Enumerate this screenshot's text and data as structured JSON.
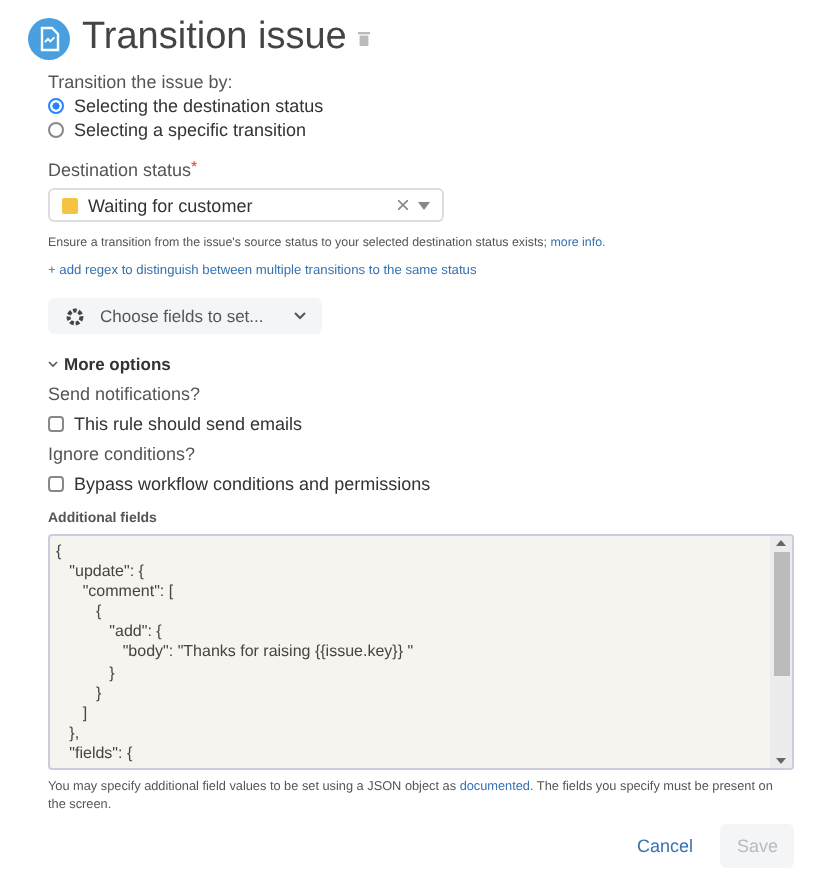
{
  "header": {
    "title": "Transition issue"
  },
  "transition_by": {
    "label": "Transition the issue by:",
    "options": [
      {
        "label": "Selecting the destination status",
        "selected": true
      },
      {
        "label": "Selecting a specific transition",
        "selected": false
      }
    ]
  },
  "destination": {
    "label": "Destination status",
    "required_mark": "*",
    "value": "Waiting for customer",
    "color": "#f5c342",
    "help": "Ensure a transition from the issue's source status to your selected destination status exists;",
    "help_link": "more info."
  },
  "regex_link": "+ add regex to distinguish between multiple transitions to the same status",
  "choose_fields": "Choose fields to set...",
  "more_options": {
    "label": "More options",
    "expanded": true
  },
  "options": [
    {
      "label": "Send notifications?",
      "checkbox": "This rule should send emails",
      "checked": false
    },
    {
      "label": "Ignore conditions?",
      "checkbox": "Bypass workflow conditions and permissions",
      "checked": false
    }
  ],
  "additional": {
    "label": "Additional fields",
    "lines": [
      "{",
      "   \"update\": {",
      "      \"comment\": [",
      "         {",
      "            \"add\": {",
      "               \"body\": \"Thanks for raising {{issue.key}} \"",
      "            }",
      "         }",
      "      ]",
      "   },",
      "   \"fields\": {"
    ],
    "help_before": "You may specify additional field values to be set using a JSON object as",
    "help_link": "documented",
    "help_after": ". The fields you specify must be present on the screen."
  },
  "buttons": [
    {
      "label": "Cancel",
      "kind": "link",
      "disabled": false
    },
    {
      "label": "Save",
      "kind": "primary",
      "disabled": true
    }
  ]
}
